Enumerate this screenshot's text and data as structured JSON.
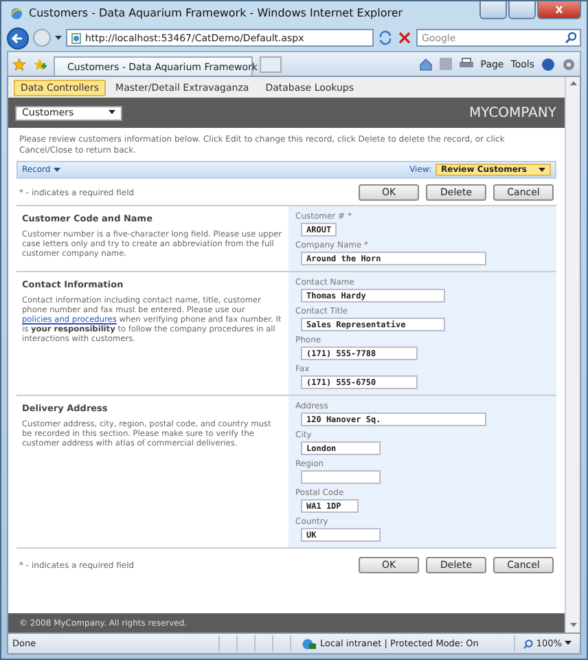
{
  "window": {
    "title": "Customers - Data Aquarium Framework - Windows Internet Explorer"
  },
  "address_bar": {
    "url": "http://localhost:53467/CatDemo/Default.aspx",
    "search_placeholder": "Google"
  },
  "browser_tab": {
    "title": "Customers - Data Aquarium Framework"
  },
  "command_bar": [
    "Page",
    "Tools"
  ],
  "nav_tabs": [
    {
      "label": "Data Controllers",
      "selected": true
    },
    {
      "label": "Master/Detail Extravaganza",
      "selected": false
    },
    {
      "label": "Database Lookups",
      "selected": false
    }
  ],
  "header": {
    "dropdown": "Customers",
    "brand": "MYCOMPANY"
  },
  "instructions": "Please review customers information below. Click Edit to change this record, click Delete to delete the record, or click Cancel/Close to return back.",
  "action_bar": {
    "menu": "Record",
    "view_label": "View:",
    "view": "Review Customers"
  },
  "required_note": "* - indicates a required field",
  "buttons": [
    "OK",
    "Delete",
    "Cancel"
  ],
  "sections": [
    {
      "title": "Customer Code and Name",
      "description": [
        {
          "kind": "text",
          "text": "Customer number is a five-character long field. Please use upper case letters only and try to create an abbreviation from the full customer company name."
        }
      ],
      "fields": [
        {
          "label": "Customer # *",
          "value": "AROUT",
          "kind": "tiny"
        },
        {
          "label": "Company Name *",
          "value": "Around the Horn",
          "kind": "long"
        }
      ]
    },
    {
      "title": "Contact Information",
      "description": [
        {
          "kind": "text",
          "text": "Contact information including contact name, title, customer phone number and fax must be entered. Please use our "
        },
        {
          "kind": "link",
          "text": "policies and procedures"
        },
        {
          "kind": "text",
          "text": " when verifying phone and fax number. It is **your responsibility** to follow the company procedures in all interactions with customers."
        }
      ],
      "fields": [
        {
          "label": "Contact Name",
          "value": "Thomas Hardy",
          "kind": "medium"
        },
        {
          "label": "Contact Title",
          "value": "Sales Representative",
          "kind": "medium"
        },
        {
          "label": "Phone",
          "value": "(171) 555-7788",
          "kind": "short"
        },
        {
          "label": "Fax",
          "value": "(171) 555-6750",
          "kind": "short"
        }
      ]
    },
    {
      "title": "Delivery Address",
      "description": [
        {
          "kind": "text",
          "text": "Customer address, city, region, postal code, and country must be recorded in this section. Please make sure to verify the customer address with atlas of commercial deliveries."
        }
      ],
      "fields": [
        {
          "label": "Address",
          "value": "120 Hanover Sq.",
          "kind": "long"
        },
        {
          "label": "City",
          "value": "London",
          "kind": "small"
        },
        {
          "label": "Region",
          "kind": "small"
        },
        {
          "label": "Postal Code",
          "value": "WA1 1DP",
          "kind": "compact"
        },
        {
          "label": "Country",
          "value": "UK",
          "kind": "small"
        }
      ]
    }
  ],
  "bottom_actions": {
    "required_note": "* - indicates a required field",
    "buttons": [
      "OK",
      "Delete",
      "Cancel"
    ]
  },
  "footer": "© 2008 MyCompany. All rights reserved.",
  "status_bar": {
    "status": "Done",
    "zone": "Local intranet | Protected Mode: On",
    "zoom": "100%"
  }
}
